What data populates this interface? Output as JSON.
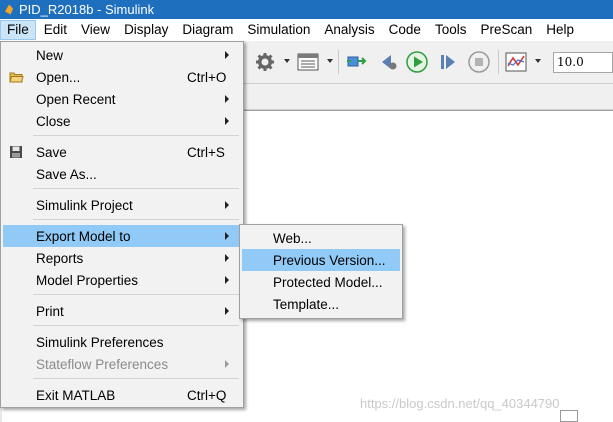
{
  "window": {
    "title": "PID_R2018b - Simulink"
  },
  "menubar": {
    "items": [
      {
        "label": "File"
      },
      {
        "label": "Edit"
      },
      {
        "label": "View"
      },
      {
        "label": "Display"
      },
      {
        "label": "Diagram"
      },
      {
        "label": "Simulation"
      },
      {
        "label": "Analysis"
      },
      {
        "label": "Code"
      },
      {
        "label": "Tools"
      },
      {
        "label": "PreScan"
      },
      {
        "label": "Help"
      }
    ]
  },
  "toolbar": {
    "stop_time": "10.0"
  },
  "file_menu": {
    "items": [
      {
        "label": "New",
        "submenu": true
      },
      {
        "label": "Open...",
        "shortcut": "Ctrl+O",
        "icon": "folder-open-icon"
      },
      {
        "label": "Open Recent",
        "submenu": true
      },
      {
        "label": "Close",
        "submenu": true
      },
      {
        "label": "Save",
        "shortcut": "Ctrl+S",
        "icon": "floppy-disk-icon"
      },
      {
        "label": "Save As..."
      },
      {
        "label": "Simulink Project",
        "submenu": true
      },
      {
        "label": "Export Model to",
        "submenu": true,
        "highlighted": true
      },
      {
        "label": "Reports",
        "submenu": true
      },
      {
        "label": "Model Properties",
        "submenu": true
      },
      {
        "label": "Print",
        "submenu": true
      },
      {
        "label": "Simulink Preferences"
      },
      {
        "label": "Stateflow Preferences",
        "submenu": true,
        "disabled": true
      },
      {
        "label": "Exit MATLAB",
        "shortcut": "Ctrl+Q"
      }
    ]
  },
  "export_submenu": {
    "items": [
      {
        "label": "Web..."
      },
      {
        "label": "Previous Version...",
        "highlighted": true
      },
      {
        "label": "Protected Model..."
      },
      {
        "label": "Template..."
      }
    ]
  },
  "watermark": "https://blog.csdn.net/qq_40344790",
  "colors": {
    "titlebar": "#1f6fbf",
    "highlight": "#91c9f7",
    "menu_bg": "#f2f2f2",
    "run_button": "#2e9e3e"
  }
}
